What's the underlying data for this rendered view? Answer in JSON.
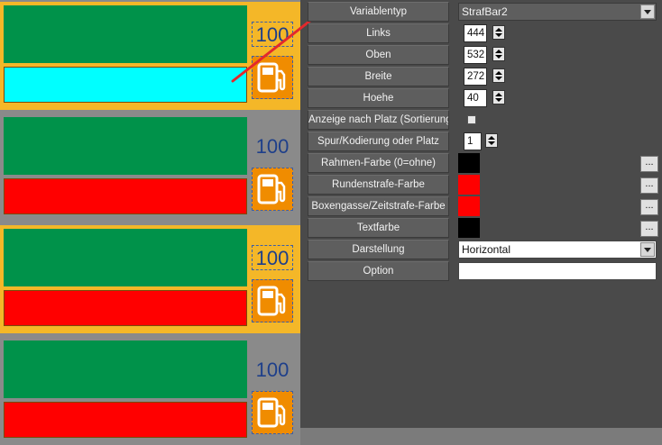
{
  "preview": {
    "cards": [
      {
        "bg": "#f4b728",
        "top": "#00924a",
        "bottom": "#00ffff",
        "number": "100",
        "number_boxed": true
      },
      {
        "bg": "#8a8a8a",
        "top": "#00924a",
        "bottom": "#ff0000",
        "number": "100",
        "number_boxed": false
      },
      {
        "bg": "#f4b728",
        "top": "#00924a",
        "bottom": "#ff0000",
        "number": "100",
        "number_boxed": true
      },
      {
        "bg": "#8a8a8a",
        "top": "#00924a",
        "bottom": "#ff0000",
        "number": "100",
        "number_boxed": false
      }
    ],
    "icons": {
      "fuel": "fuel-pump-icon"
    },
    "pointer_color": "#e3282c"
  },
  "properties": {
    "rows": [
      {
        "label": "Variablentyp",
        "kind": "combo-dark",
        "value": "StrafBar2"
      },
      {
        "label": "Links",
        "kind": "spin",
        "value": "444"
      },
      {
        "label": "Oben",
        "kind": "spin",
        "value": "532"
      },
      {
        "label": "Breite",
        "kind": "spin",
        "value": "272"
      },
      {
        "label": "Hoehe",
        "kind": "spin",
        "value": "40"
      },
      {
        "label": "Anzeige nach Platz (Sortierung)",
        "kind": "checkbox",
        "value": ""
      },
      {
        "label": "Spur/Kodierung oder Platz",
        "kind": "spin",
        "value": "1"
      },
      {
        "label": "Rahmen-Farbe (0=ohne)",
        "kind": "color",
        "color": "#000000",
        "button": "..."
      },
      {
        "label": "Rundenstrafe-Farbe",
        "kind": "color",
        "color": "#ff0000",
        "button": "..."
      },
      {
        "label": "Boxengasse/Zeitstrafe-Farbe",
        "kind": "color",
        "color": "#ff0000",
        "button": "..."
      },
      {
        "label": "Textfarbe",
        "kind": "color",
        "color": "#000000",
        "button": "..."
      },
      {
        "label": "Darstellung",
        "kind": "combo",
        "value": "Horizontal"
      },
      {
        "label": "Option",
        "kind": "text",
        "value": ""
      }
    ]
  }
}
